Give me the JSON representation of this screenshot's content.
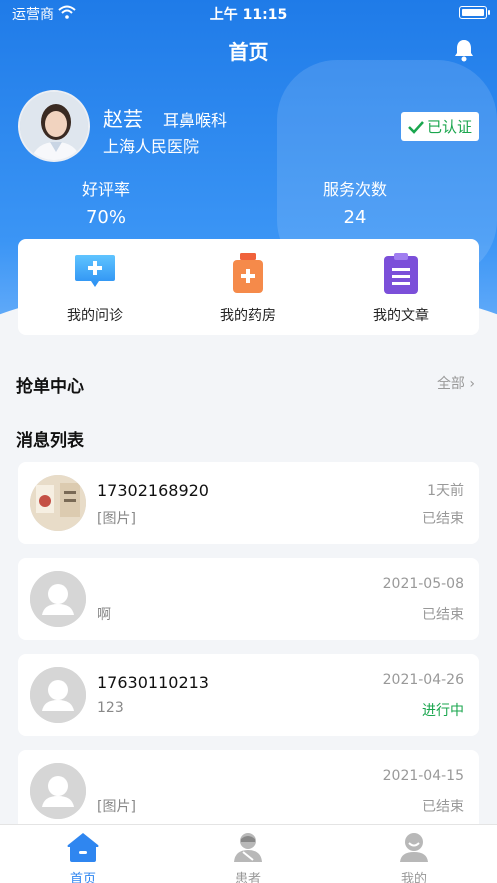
{
  "status_bar": {
    "carrier": "运营商",
    "time": "上午 11:15"
  },
  "nav": {
    "title": "首页"
  },
  "doctor": {
    "name": "赵芸",
    "department": "耳鼻喉科",
    "hospital": "上海人民医院",
    "verified_label": "已认证"
  },
  "stats": [
    {
      "label": "好评率",
      "value": "70%"
    },
    {
      "label": "服务次数",
      "value": "24"
    }
  ],
  "quick_actions": [
    {
      "label": "我的问诊",
      "icon": "chat-plus-icon"
    },
    {
      "label": "我的药房",
      "icon": "medicine-bottle-icon"
    },
    {
      "label": "我的文章",
      "icon": "clipboard-icon"
    }
  ],
  "grab_section": {
    "title": "抢单中心",
    "all_label": "全部",
    "chevron": "›"
  },
  "messages_section": {
    "title": "消息列表"
  },
  "messages": [
    {
      "name": "17302168920",
      "preview": "[图片]",
      "time": "1天前",
      "status": "已结束"
    },
    {
      "name": "",
      "preview": "啊",
      "time": "2021-05-08",
      "status": "已结束"
    },
    {
      "name": "17630110213",
      "preview": "123",
      "time": "2021-04-26",
      "status": "进行中"
    },
    {
      "name": "",
      "preview": "[图片]",
      "time": "2021-04-15",
      "status": "已结束"
    }
  ],
  "tabs": [
    {
      "label": "首页",
      "icon": "home-icon",
      "active": true
    },
    {
      "label": "患者",
      "icon": "patient-icon",
      "active": false
    },
    {
      "label": "我的",
      "icon": "profile-icon",
      "active": false
    }
  ],
  "colors": {
    "primary": "#2f86f0",
    "success": "#1aa64e",
    "muted": "#999999"
  }
}
